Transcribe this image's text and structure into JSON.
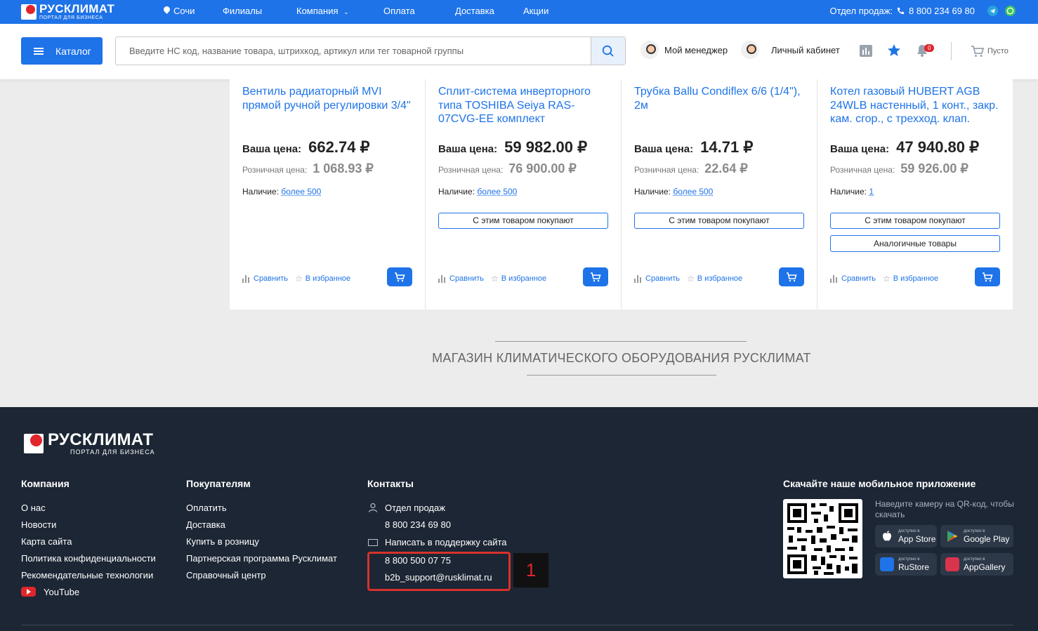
{
  "topbar": {
    "logo_main": "РУСКЛИМАТ",
    "logo_sub": "ПОРТАЛ ДЛЯ БИЗНЕСА",
    "city": "Сочи",
    "nav": [
      "Филиалы",
      "Компания",
      "Оплата",
      "Доставка",
      "Акции"
    ],
    "sales_label": "Отдел продаж:",
    "sales_phone": "8 800 234 69 80"
  },
  "header": {
    "catalog_label": "Каталог",
    "search_placeholder": "Введите НС код, название товара, штрихкод, артикул или тег товарной группы",
    "manager_label": "Мой менеджер",
    "cabinet_label": "Личный кабинет",
    "notifications_count": "0",
    "cart_label": "Пусто"
  },
  "colors": {
    "accent": "#1e73e8",
    "footer_bg": "#1c2634",
    "highlight": "#d7322c"
  },
  "products": [
    {
      "title": "Вентиль радиаторный MVI прямой ручной регулировки 3/4\"",
      "price_label": "Ваша цена:",
      "price": "662.74 ₽",
      "retail_label": "Розничная цена:",
      "retail": "1 068.93 ₽",
      "stock_label": "Наличие:",
      "stock": "более 500",
      "buttons": [],
      "compare": "Сравнить",
      "favorite": "В избранное"
    },
    {
      "title": "Сплит-система инверторного типа TOSHIBA Seiya RAS-07CVG-EE комплект",
      "price_label": "Ваша цена:",
      "price": "59 982.00 ₽",
      "retail_label": "Розничная цена:",
      "retail": "76 900.00 ₽",
      "stock_label": "Наличие:",
      "stock": "более 500",
      "buttons": [
        "С этим товаром покупают"
      ],
      "compare": "Сравнить",
      "favorite": "В избранное"
    },
    {
      "title": "Трубка Ballu Condiflex 6/6 (1/4\"), 2м",
      "price_label": "Ваша цена:",
      "price": "14.71 ₽",
      "retail_label": "Розничная цена:",
      "retail": "22.64 ₽",
      "stock_label": "Наличие:",
      "stock": "более 500",
      "buttons": [
        "С этим товаром покупают"
      ],
      "compare": "Сравнить",
      "favorite": "В избранное"
    },
    {
      "title": "Котел газовый HUBERT AGB 24WLB настенный, 1 конт., закр. кам. сгор., с трехход. клап.",
      "price_label": "Ваша цена:",
      "price": "47 940.80 ₽",
      "retail_label": "Розничная цена:",
      "retail": "59 926.00 ₽",
      "stock_label": "Наличие:",
      "stock": "1",
      "buttons": [
        "С этим товаром покупают",
        "Аналогичные товары"
      ],
      "compare": "Сравнить",
      "favorite": "В избранное"
    }
  ],
  "store_heading": "МАГАЗИН КЛИМАТИЧЕСКОГО ОБОРУДОВАНИЯ РУСКЛИМАТ",
  "footer": {
    "logo_main": "РУСКЛИМАТ",
    "logo_sub": "ПОРТАЛ ДЛЯ БИЗНЕСА",
    "company": {
      "title": "Компания",
      "links": [
        "О нас",
        "Новости",
        "Карта сайта",
        "Политика конфиденциальности",
        "Рекомендательные технологии",
        "YouTube"
      ]
    },
    "buyers": {
      "title": "Покупателям",
      "links": [
        "Оплатить",
        "Доставка",
        "Купить в розницу",
        "Партнерская программа Русклимат",
        "Справочный центр"
      ]
    },
    "contacts": {
      "title": "Контакты",
      "sales_dept": "Отдел продаж",
      "sales_phone": "8 800 234 69 80",
      "support_label": "Написать в поддержку сайта",
      "support_phone": "8 800 500 07 75",
      "support_email": "b2b_support@rusklimat.ru"
    },
    "annotation_number": "1",
    "app": {
      "title": "Скачайте наше мобильное приложение",
      "hint": "Наведите камеру на QR-код, чтобы скачать",
      "stores": [
        {
          "small": "доступно в",
          "name": "App Store"
        },
        {
          "small": "доступно в",
          "name": "Google Play"
        },
        {
          "small": "доступно в",
          "name": "RuStore"
        },
        {
          "small": "доступно в",
          "name": "AppGallery"
        }
      ]
    }
  }
}
